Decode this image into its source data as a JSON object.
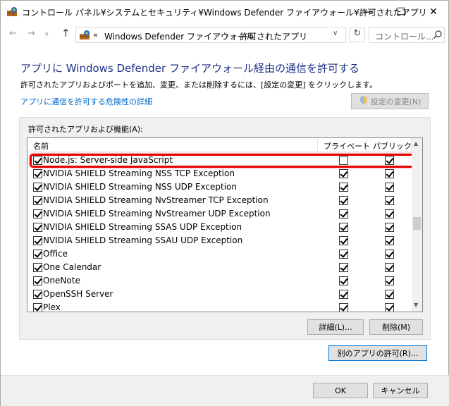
{
  "window": {
    "title": "コントロール パネル¥システムとセキュリティ¥Windows Defender ファイアウォール¥許可されたアプリ",
    "minimize": "—",
    "maximize": "☐",
    "close": "✕"
  },
  "nav": {
    "back": "←",
    "forward": "→",
    "recent": "∨",
    "up": "↑",
    "crumb_sep": "«",
    "crumb_arrow": "›",
    "breadcrumb1": "Windows Defender ファイアウォール",
    "breadcrumb2": "許可されたアプリ",
    "dropdown": "∨",
    "refresh": "↻",
    "search_placeholder": "コントロール..."
  },
  "main": {
    "heading": "アプリに Windows Defender ファイアウォール経由の通信を許可する",
    "description": "許可されたアプリおよびポートを追加、変更、または削除するには、[設定の変更] をクリックします。",
    "risk_link": "アプリに通信を許可する危険性の詳細",
    "change_settings_button": "設定の変更(N)",
    "group_title": "許可されたアプリおよび機能(A):",
    "columns": {
      "name": "名前",
      "private": "プライベート",
      "public": "パブリック"
    },
    "rows": [
      {
        "name": "Node.js: Server-side JavaScript",
        "enabled": true,
        "private": false,
        "public": true
      },
      {
        "name": "NVIDIA SHIELD Streaming NSS TCP Exception",
        "enabled": true,
        "private": true,
        "public": true
      },
      {
        "name": "NVIDIA SHIELD Streaming NSS UDP Exception",
        "enabled": true,
        "private": true,
        "public": true
      },
      {
        "name": "NVIDIA SHIELD Streaming NvStreamer TCP Exception",
        "enabled": true,
        "private": true,
        "public": true
      },
      {
        "name": "NVIDIA SHIELD Streaming NvStreamer UDP Exception",
        "enabled": true,
        "private": true,
        "public": true
      },
      {
        "name": "NVIDIA SHIELD Streaming SSAS UDP Exception",
        "enabled": true,
        "private": true,
        "public": true
      },
      {
        "name": "NVIDIA SHIELD Streaming SSAU UDP Exception",
        "enabled": true,
        "private": true,
        "public": true
      },
      {
        "name": "Office",
        "enabled": true,
        "private": true,
        "public": true
      },
      {
        "name": "One Calendar",
        "enabled": true,
        "private": true,
        "public": true
      },
      {
        "name": "OneNote",
        "enabled": true,
        "private": true,
        "public": true
      },
      {
        "name": "OpenSSH Server",
        "enabled": true,
        "private": true,
        "public": true
      },
      {
        "name": "Plex",
        "enabled": true,
        "private": true,
        "public": true
      }
    ],
    "details_button": "詳細(L)...",
    "remove_button": "削除(M)",
    "allow_other_button": "別のアプリの許可(R)..."
  },
  "footer": {
    "ok": "OK",
    "cancel": "キャンセル"
  },
  "colors": {
    "heading": "#1e3287",
    "link": "#0066cc",
    "highlight": "#e60000"
  }
}
